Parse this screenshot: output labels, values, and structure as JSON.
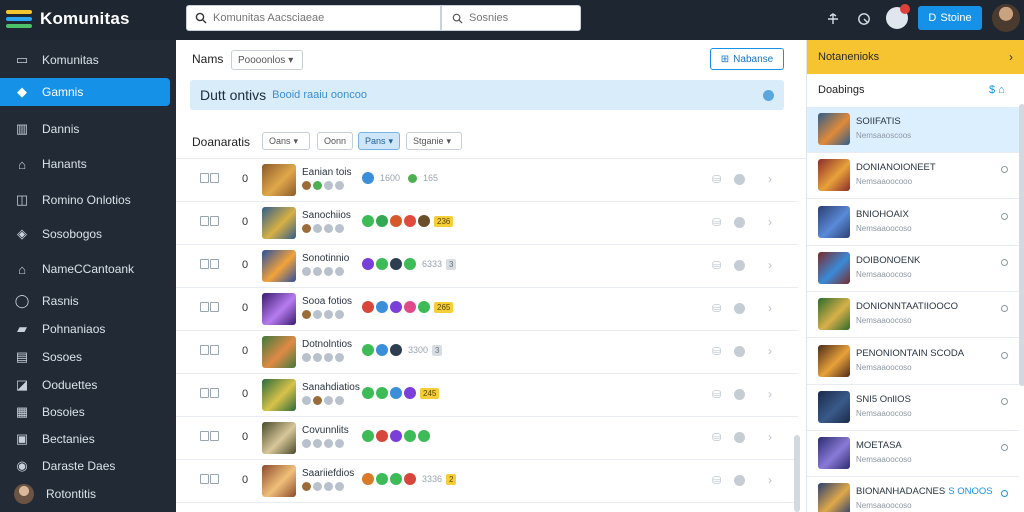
{
  "app": {
    "title": "Komunitas",
    "logo_colors": [
      "#f5c530",
      "#2ea6f0",
      "#4cc06a",
      "#e24b4b"
    ]
  },
  "topbar": {
    "search_placeholder": "Komunitas Aacsciaeae",
    "search2_placeholder": "Sosnies",
    "button_label": "Stoine",
    "button_icon": "D",
    "icons": [
      "share-icon",
      "globe-icon"
    ],
    "accent": "#1592e8"
  },
  "sidebar": {
    "items": [
      {
        "label": "Komunitas",
        "icon": "board-icon"
      },
      {
        "label": "Gamnis",
        "icon": "gamepad-icon",
        "active": true
      },
      {
        "label": "Dannis",
        "icon": "chart-icon"
      },
      {
        "label": "Hanants",
        "icon": "home-icon"
      },
      {
        "label": "Romino Onlotios",
        "icon": "controller-icon"
      },
      {
        "label": "Sosobogos",
        "icon": "tag-icon"
      },
      {
        "label": "NameCCantoank",
        "icon": "house-icon"
      },
      {
        "label": "Rasnis",
        "icon": "user-icon"
      },
      {
        "label": "Pohnaniaos",
        "icon": "folder-icon"
      },
      {
        "label": "Sosoes",
        "icon": "list-icon"
      },
      {
        "label": "Ooduettes",
        "icon": "box-icon"
      },
      {
        "label": "Bosoies",
        "icon": "doc-icon"
      },
      {
        "label": "Bectanies",
        "icon": "grid-icon"
      },
      {
        "label": "Daraste Daes",
        "icon": "pin-icon"
      },
      {
        "label": "Rotontitis",
        "icon": "avatar"
      }
    ]
  },
  "main": {
    "name_label": "Nams",
    "name_select": "Poooonlos",
    "top_button": "Nabanse",
    "banner_title": "Dutt ontivs",
    "banner_sub": "Booid raaiu ooncoo",
    "filter_label": "Doanaratis",
    "filters": [
      {
        "label": "Oans",
        "caret": true
      },
      {
        "label": "Oonn",
        "caret": false
      },
      {
        "label": "Pans",
        "caret": true,
        "active": true
      },
      {
        "label": "Stganie",
        "caret": true
      }
    ],
    "rows": [
      {
        "count": "0",
        "title": "Eanian tois",
        "thumb": [
          "#8b5a2b",
          "#e0a84a"
        ],
        "subs": [
          "brown",
          "green",
          "",
          ""
        ],
        "tags": [
          {
            "c": "#3b8fd8"
          }
        ],
        "num": "1600",
        "extra_tags": [
          {
            "c": "#4caf50"
          }
        ],
        "num2": "165"
      },
      {
        "count": "0",
        "title": "Sanochiios",
        "thumb": [
          "#2f5d8a",
          "#d8b045"
        ],
        "subs": [
          "brown",
          "",
          "",
          ""
        ],
        "tags": [
          {
            "c": "#3dbb57"
          },
          {
            "c": "#32a852"
          },
          {
            "c": "#d45a2a"
          },
          {
            "c": "#e04a3a"
          },
          {
            "c": "#6b4e2a"
          }
        ],
        "pill": {
          "t": "236",
          "k": "yellow"
        }
      },
      {
        "count": "0",
        "title": "Sonotinnio",
        "thumb": [
          "#2b4fa2",
          "#f2a33a"
        ],
        "subs": [
          "",
          "",
          "",
          ""
        ],
        "tags": [
          {
            "c": "#7a3fd8"
          },
          {
            "c": "#3dbb57"
          },
          {
            "c": "#2c3e50"
          },
          {
            "c": "#3dbb57"
          }
        ],
        "num": "6333",
        "pill": {
          "t": "3",
          "k": "grey"
        }
      },
      {
        "count": "0",
        "title": "Sooa fotios",
        "thumb": [
          "#3b1b6e",
          "#b77cf0"
        ],
        "subs": [
          "brown",
          "",
          "",
          ""
        ],
        "tags": [
          {
            "c": "#d8453a"
          },
          {
            "c": "#3b8fd8"
          },
          {
            "c": "#7a3fd8"
          },
          {
            "c": "#e04a8a"
          },
          {
            "c": "#3dbb57"
          }
        ],
        "pill": {
          "t": "265",
          "k": "yellow"
        }
      },
      {
        "count": "0",
        "title": "Dotnolntios",
        "thumb": [
          "#3f7a3b",
          "#e08a45"
        ],
        "subs": [
          "",
          "",
          "",
          ""
        ],
        "tags": [
          {
            "c": "#3dbb57"
          },
          {
            "c": "#3b8fd8"
          },
          {
            "c": "#2c3e50"
          }
        ],
        "num": "3300",
        "pill": {
          "t": "3",
          "k": "grey"
        }
      },
      {
        "count": "0",
        "title": "Sanahdiatios",
        "thumb": [
          "#2b6b3a",
          "#d8c24a"
        ],
        "subs": [
          "",
          "brown",
          "",
          ""
        ],
        "tags": [
          {
            "c": "#3dbb57"
          },
          {
            "c": "#3dbb57"
          },
          {
            "c": "#3b8fd8"
          },
          {
            "c": "#7a3fd8"
          }
        ],
        "pill": {
          "t": "245",
          "k": "yellow"
        }
      },
      {
        "count": "0",
        "title": "Covunnlits",
        "thumb": [
          "#4a4a2a",
          "#d8c79a"
        ],
        "subs": [
          "",
          "",
          "",
          ""
        ],
        "tags": [
          {
            "c": "#3dbb57"
          },
          {
            "c": "#d8453a"
          },
          {
            "c": "#7a3fd8"
          },
          {
            "c": "#3dbb57"
          },
          {
            "c": "#3dbb57"
          }
        ]
      },
      {
        "count": "0",
        "title": "Saariiefdios",
        "thumb": [
          "#8b4a2b",
          "#f0c07a"
        ],
        "subs": [
          "brown",
          "",
          "",
          ""
        ],
        "tags": [
          {
            "c": "#d87a2a"
          },
          {
            "c": "#3dbb57"
          },
          {
            "c": "#3dbb57"
          },
          {
            "c": "#d8453a"
          }
        ],
        "num": "3336",
        "pill": {
          "t": "2",
          "k": "yellow"
        }
      }
    ]
  },
  "right": {
    "header": "Notanenioks",
    "sub": "Doabings",
    "sub_action": "$",
    "items": [
      {
        "name": "SOIIFATIS",
        "desc": "Nemsaaoscoos",
        "thumb": [
          "#2f5d8a",
          "#e08a3a"
        ],
        "selected": true
      },
      {
        "name": "DONIANOIONEET",
        "desc": "Nemsaaoocooo",
        "thumb": [
          "#8b2b2b",
          "#e8a23a"
        ]
      },
      {
        "name": "BNIOHOAIX",
        "desc": "Nemsaaoocoso",
        "thumb": [
          "#2b3f6e",
          "#5a8ad8"
        ]
      },
      {
        "name": "DOIBONOENK",
        "desc": "Nemsaaoocoso",
        "thumb": [
          "#7a2b2b",
          "#3a8ad8"
        ]
      },
      {
        "name": "DONIONNTAATIIOOCO",
        "desc": "Nemsaaoocoso",
        "thumb": [
          "#2b6b2b",
          "#d8b04a"
        ]
      },
      {
        "name": "PENONIONTAIN SCODA",
        "desc": "Nemsaaoocoso",
        "thumb": [
          "#4a2b1a",
          "#e8a23a"
        ]
      },
      {
        "name": "SNI5 OnlIOS",
        "desc": "Nemsaaoocoso",
        "thumb": [
          "#1a2b4a",
          "#3a5a8a"
        ]
      },
      {
        "name": "MOETASA",
        "desc": "Nemsaaoocoso",
        "thumb": [
          "#2b2b6e",
          "#8a7ad8"
        ]
      },
      {
        "name": "BIONANHADACNES",
        "suffix": "S ONOOS",
        "desc": "Nemsaaoocoso",
        "thumb": [
          "#2b3f6e",
          "#e0a84a"
        ],
        "blue": true
      }
    ]
  }
}
